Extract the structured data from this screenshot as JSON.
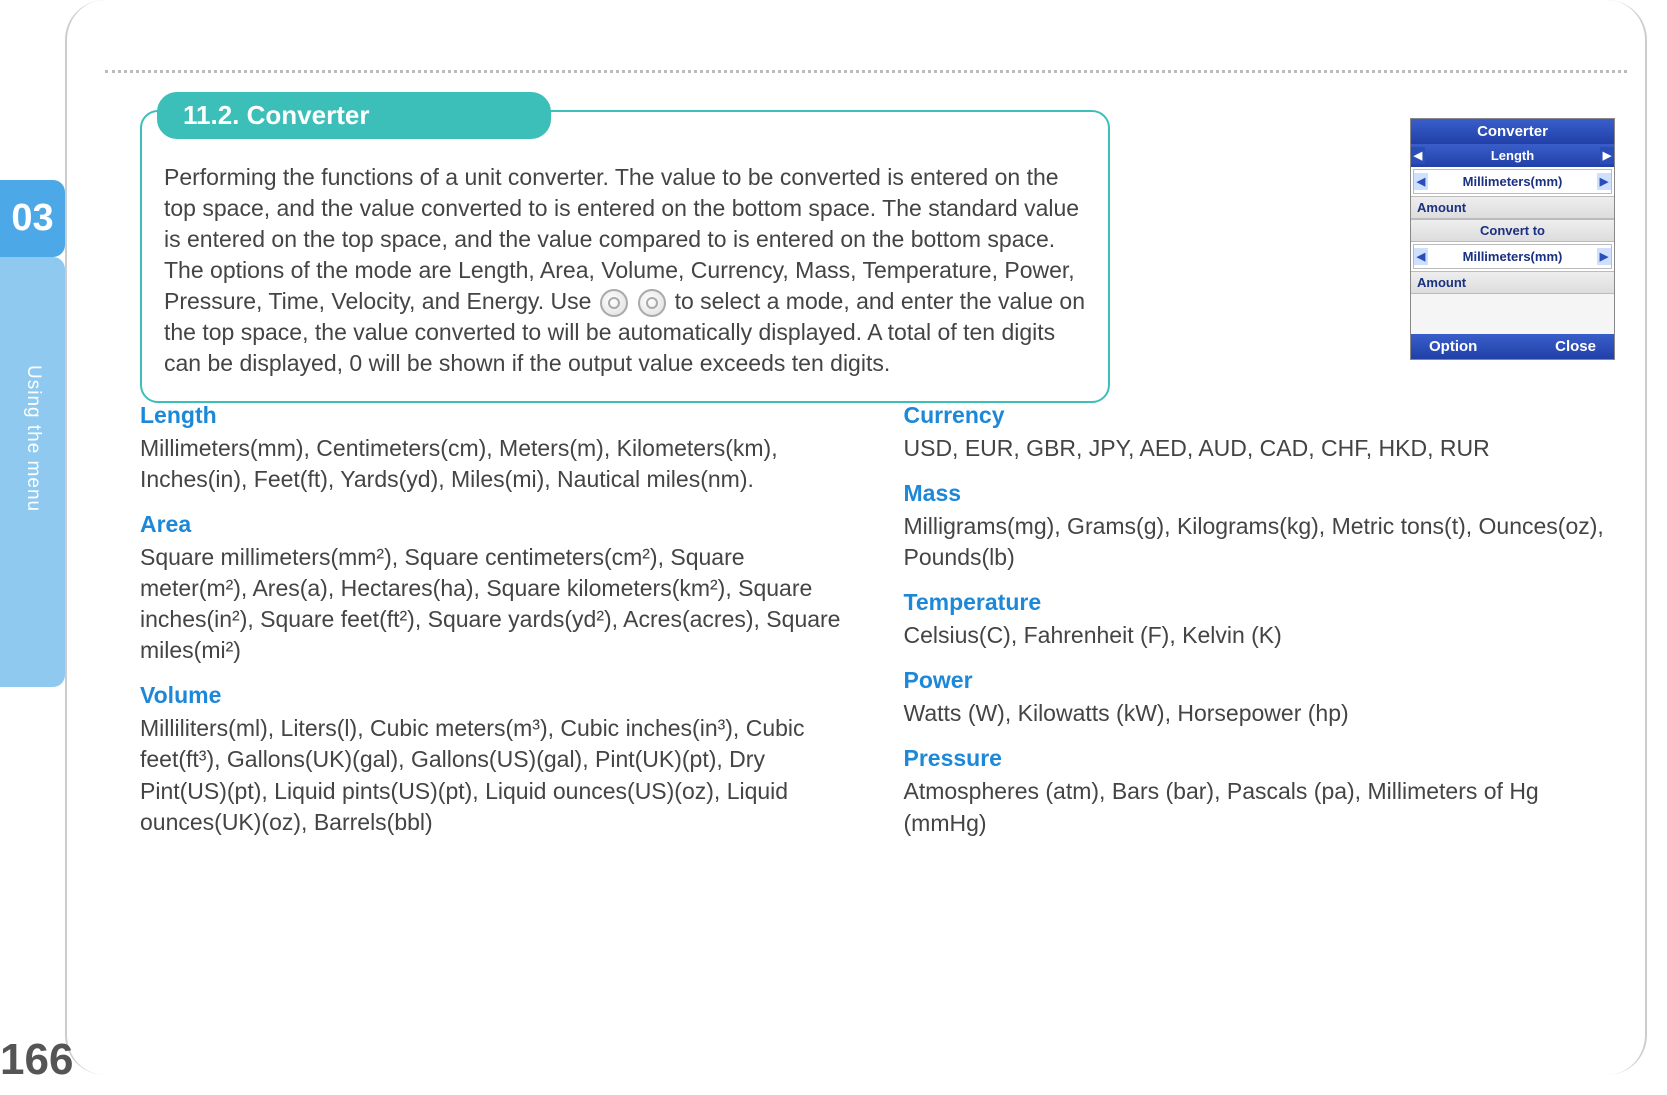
{
  "chapter_number": "03",
  "side_tab_label": "Using the menu",
  "page_number": "166",
  "section": {
    "title": "11.2. Converter",
    "body_part1": "Performing the functions of a unit converter.\nThe value to be converted is entered on the top space, and the value converted to is entered on the bottom space. The standard value is entered on the top space, and the value compared to is entered on the bottom space. The options of the mode are Length, Area, Volume, Currency, Mass, Temperature, Power, Pressure, Time, Velocity, and Energy. Use ",
    "body_part2": " to select a mode, and enter the value on the top space, the value converted to will be automatically displayed. A total of ten digits can be displayed, 0 will be shown if the output value exceeds ten digits."
  },
  "categories_left": [
    {
      "title": "Length",
      "body": "Millimeters(mm), Centimeters(cm), Meters(m), Kilometers(km), Inches(in), Feet(ft), Yards(yd), Miles(mi), Nautical miles(nm)."
    },
    {
      "title": "Area",
      "body": "Square millimeters(mm²), Square centimeters(cm²), Square meter(m²), Ares(a), Hectares(ha), Square kilometers(km²), Square inches(in²), Square feet(ft²), Square yards(yd²), Acres(acres), Square miles(mi²)"
    },
    {
      "title": "Volume",
      "body": "Milliliters(ml), Liters(l), Cubic meters(m³), Cubic inches(in³), Cubic feet(ft³), Gallons(UK)(gal), Gallons(US)(gal), Pint(UK)(pt), Dry Pint(US)(pt), Liquid pints(US)(pt), Liquid ounces(US)(oz), Liquid ounces(UK)(oz), Barrels(bbl)"
    }
  ],
  "categories_right": [
    {
      "title": "Currency",
      "body": "USD, EUR, GBR, JPY, AED, AUD, CAD, CHF, HKD, RUR"
    },
    {
      "title": "Mass",
      "body": "Milligrams(mg), Grams(g), Kilograms(kg), Metric tons(t), Ounces(oz), Pounds(lb)"
    },
    {
      "title": "Temperature",
      "body": "Celsius(C), Fahrenheit (F), Kelvin (K)"
    },
    {
      "title": "Power",
      "body": "Watts (W), Kilowatts (kW), Horsepower (hp)"
    },
    {
      "title": "Pressure",
      "body": "Atmospheres (atm), Bars (bar), Pascals (pa), Millimeters of Hg (mmHg)"
    }
  ],
  "phone": {
    "title": "Converter",
    "category": "Length",
    "from_unit": "Millimeters(mm)",
    "amount_label": "Amount",
    "convert_label": "Convert to",
    "to_unit": "Millimeters(mm)",
    "softkey_left": "Option",
    "softkey_right": "Close"
  }
}
